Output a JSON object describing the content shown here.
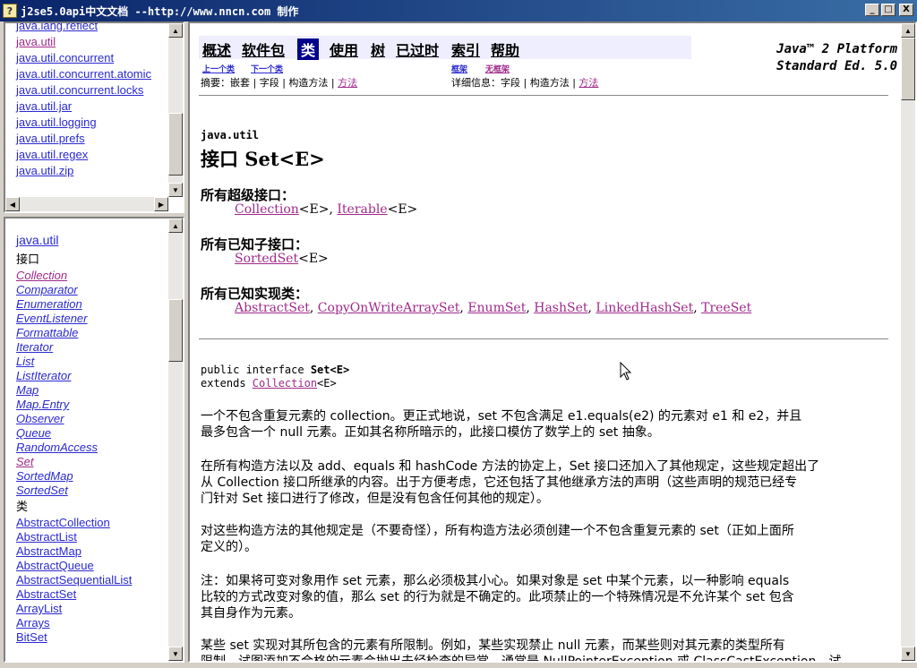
{
  "window": {
    "title": "j2se5.0api中文文档 --http://www.nncn.com 制作",
    "min": "_",
    "max": "□",
    "close": "X"
  },
  "scroll": {
    "up": "▲",
    "down": "▼",
    "left": "◀",
    "right": "▶"
  },
  "packages": [
    "java.lang.reflect",
    "java.util",
    "java.util.concurrent",
    "java.util.concurrent.atomic",
    "java.util.concurrent.locks",
    "java.util.jar",
    "java.util.logging",
    "java.util.prefs",
    "java.util.regex",
    "java.util.zip"
  ],
  "classes": {
    "package": "java.util",
    "interfaces_header": "接口",
    "interfaces": [
      "Collection",
      "Comparator",
      "Enumeration",
      "EventListener",
      "Formattable",
      "Iterator",
      "List",
      "ListIterator",
      "Map",
      "Map.Entry",
      "Observer",
      "Queue",
      "RandomAccess",
      "Set",
      "SortedMap",
      "SortedSet"
    ],
    "classes_header": "类",
    "classes": [
      "AbstractCollection",
      "AbstractList",
      "AbstractMap",
      "AbstractQueue",
      "AbstractSequentialList",
      "AbstractSet",
      "ArrayList",
      "Arrays",
      "BitSet"
    ]
  },
  "nav": {
    "overview": "概述",
    "package": "软件包",
    "class": "类",
    "use": "使用",
    "tree": "树",
    "deprecated": "已过时",
    "index": "索引",
    "help": "帮助",
    "prev": "上一个类",
    "next": "下一个类",
    "frames": "框架",
    "noframes": "无框架"
  },
  "platform": {
    "line1": "Java™ 2 Platform",
    "line2": "Standard Ed. 5.0"
  },
  "summary": {
    "label": "摘要：",
    "nested": "嵌套",
    "field": "字段",
    "ctor": "构造方法",
    "method": "方法",
    "detail_label": "详细信息：",
    "d_field": "字段",
    "d_ctor": "构造方法",
    "d_method": "方法"
  },
  "content": {
    "package": "java.util",
    "title": "接口 Set<E>",
    "superinterfaces_label": "所有超级接口：",
    "superinterfaces": {
      "a": "Collection",
      "a_tail": "<E>, ",
      "b": "Iterable",
      "b_tail": "<E>"
    },
    "subinterfaces_label": "所有已知子接口：",
    "subinterfaces": {
      "a": "SortedSet",
      "a_tail": "<E>"
    },
    "impl_label": "所有已知实现类：",
    "impl": [
      "AbstractSet",
      "CopyOnWriteArraySet",
      "EnumSet",
      "HashSet",
      "LinkedHashSet",
      "TreeSet"
    ],
    "decl1_prefix": "public interface ",
    "decl1_name": "Set<E>",
    "decl2_prefix": "extends ",
    "decl2_link": "Collection",
    "decl2_tail": "<E>",
    "p1_l1": "一个不包含重复元素的 collection。更正式地说，set 不包含满足 e1.equals(e2) 的元素对 e1 和 e2，并且",
    "p1_l2": "最多包含一个 null 元素。正如其名称所暗示的，此接口模仿了数学上的 set 抽象。",
    "p2_l1": "在所有构造方法以及 add、equals 和 hashCode 方法的协定上，Set 接口还加入了其他规定，这些规定超出了",
    "p2_l2": "从 Collection 接口所继承的内容。出于方便考虑，它还包括了其他继承方法的声明（这些声明的规范已经专",
    "p2_l3": "门针对 Set 接口进行了修改，但是没有包含任何其他的规定）。",
    "p3_l1": "对这些构造方法的其他规定是（不要奇怪），所有构造方法必须创建一个不包含重复元素的 set（正如上面所",
    "p3_l2": "定义的）。",
    "p4_l1": "注：如果将可变对象用作 set 元素，那么必须极其小心。如果对象是 set 中某个元素，以一种影响 equals",
    "p4_l2": "比较的方式改变对象的值，那么 set 的行为就是不确定的。此项禁止的一个特殊情况是不允许某个 set 包含",
    "p4_l3": "其自身作为元素。",
    "p5_l1": "某些 set 实现对其所包含的元素有所限制。例如，某些实现禁止 null 元素，而某些则对其元素的类型所有",
    "p5_l2": "限制。试图添加不合格的元素会抛出未经检查的异常，通常是 NullPointerException 或 ClassCastException。试"
  },
  "colors": {
    "link": "#2a2ad0",
    "visited": "#a02a8a",
    "navbar_bg": "#eeeeff",
    "nav_current": "#00008b"
  }
}
